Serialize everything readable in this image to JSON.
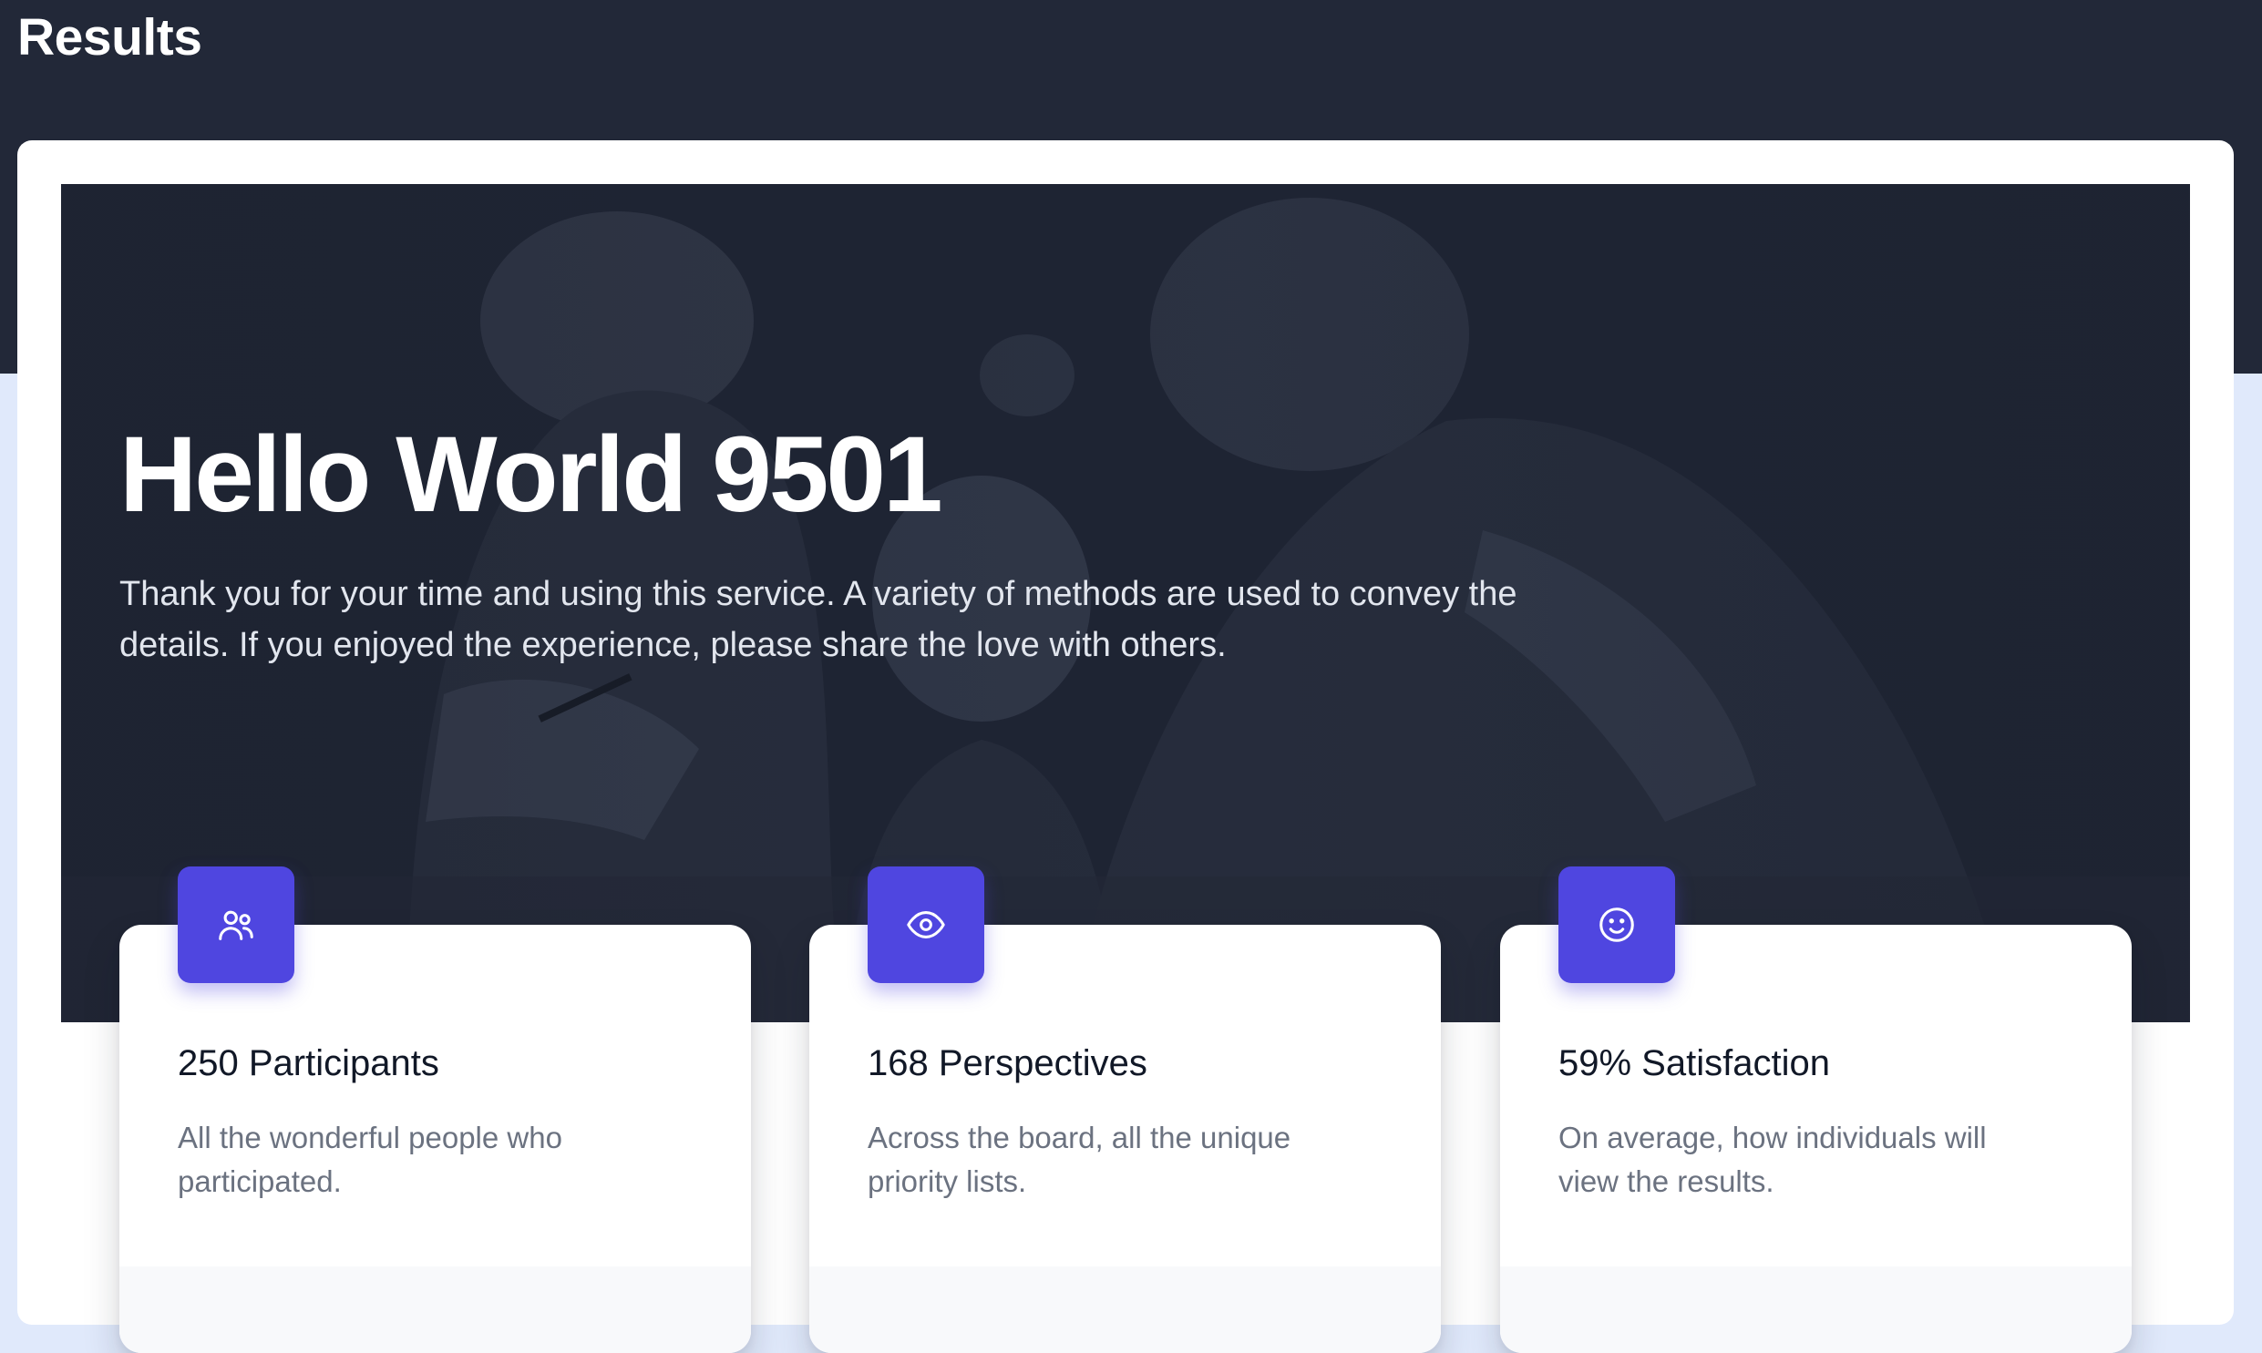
{
  "page": {
    "title": "Results"
  },
  "hero": {
    "heading": "Hello World 9501",
    "text": "Thank you for your time and using this service. A variety of methods are used to convey the details. If you enjoyed the experience, please share the love with others."
  },
  "stats": [
    {
      "icon": "users-icon",
      "title": "250 Participants",
      "description": "All the wonderful people who participated."
    },
    {
      "icon": "eye-icon",
      "title": "168 Perspectives",
      "description": "Across the board, all the unique priority lists."
    },
    {
      "icon": "smile-icon",
      "title": "59% Satisfaction",
      "description": "On average, how individuals will view the results."
    }
  ],
  "colors": {
    "header_bg": "#222838",
    "page_bg": "#e0e9fb",
    "accent": "#4f46e0",
    "card_title": "#111827",
    "card_text": "#6b7280"
  }
}
